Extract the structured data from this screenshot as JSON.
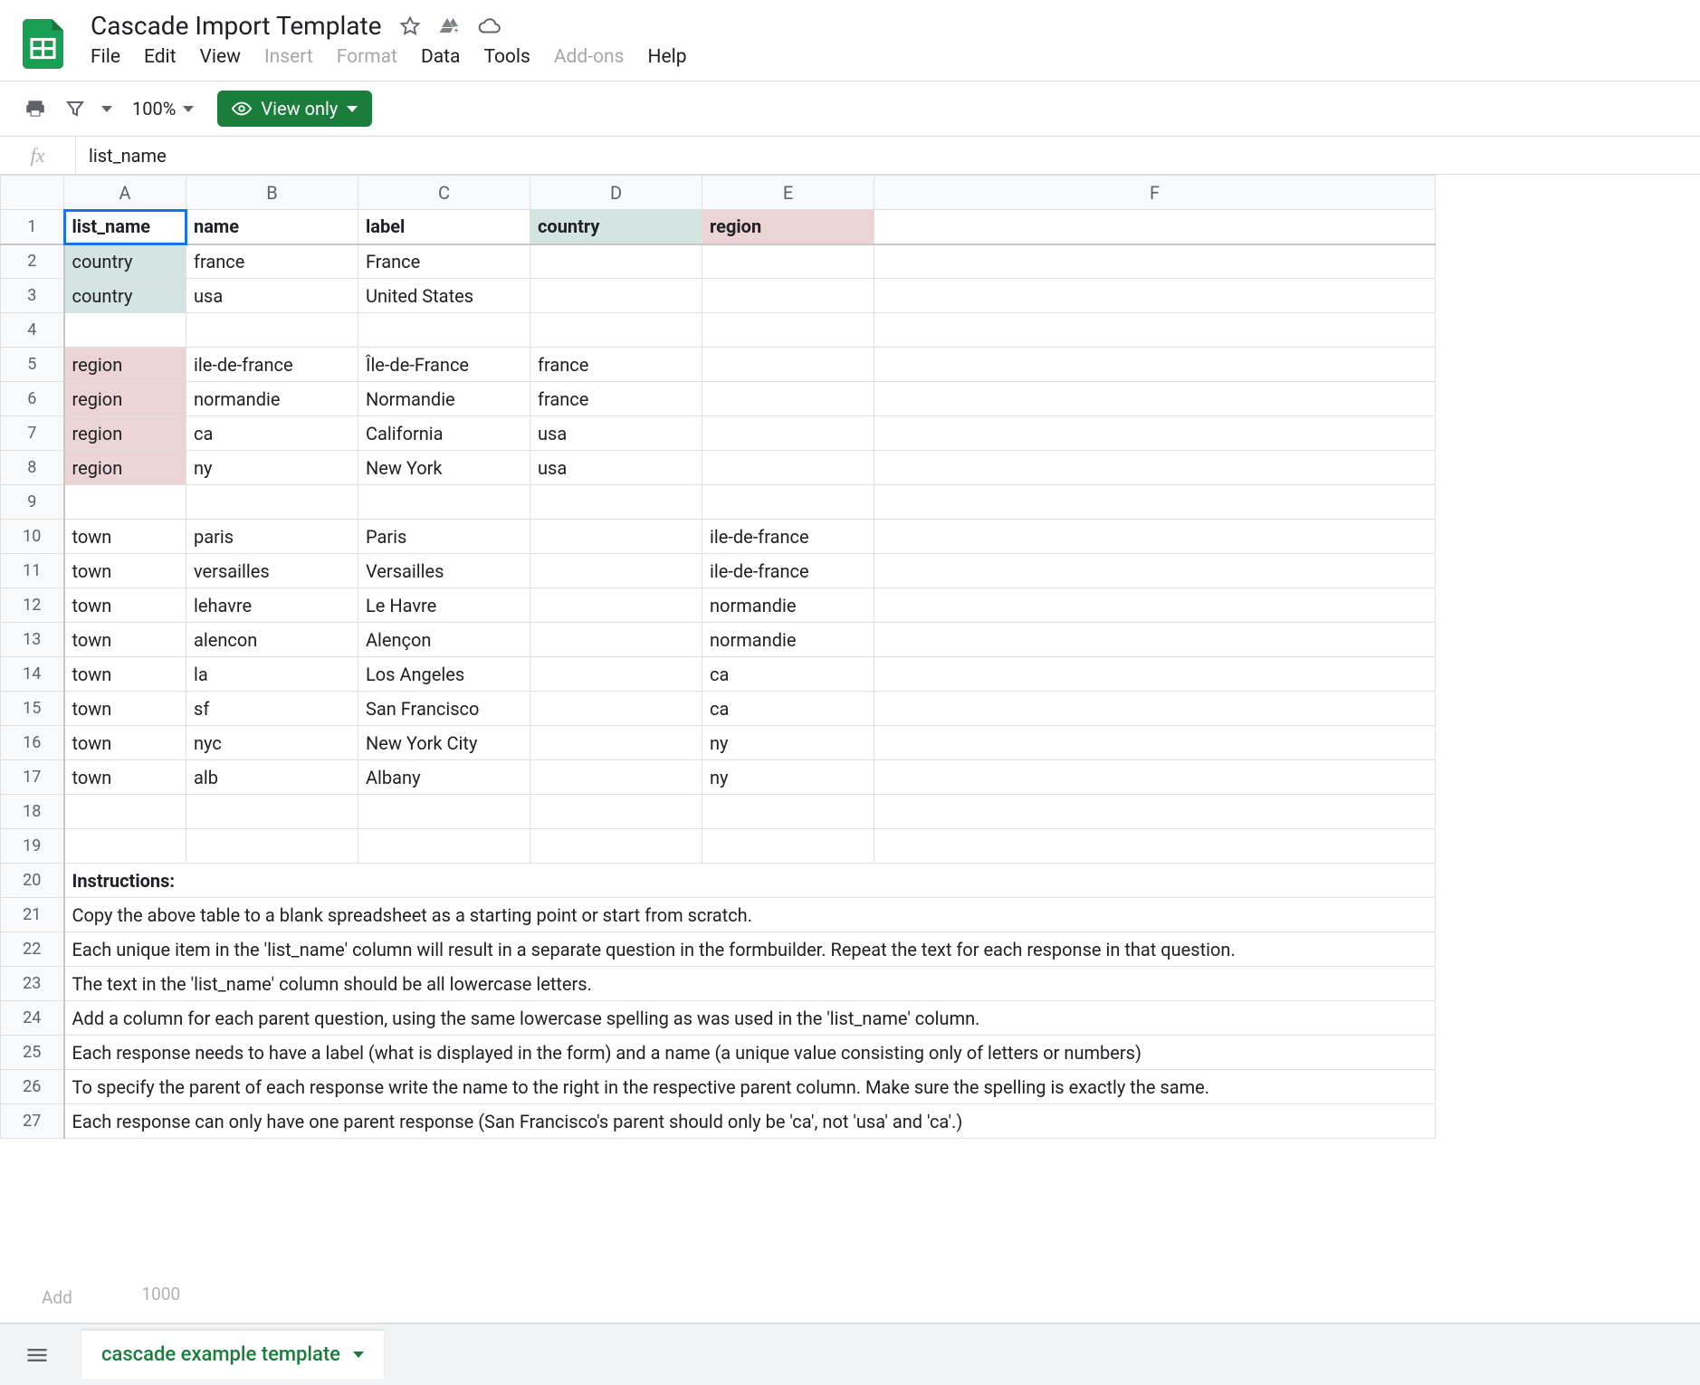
{
  "doc_title": "Cascade Import Template",
  "menus": {
    "file": "File",
    "edit": "Edit",
    "view": "View",
    "insert": "Insert",
    "format": "Format",
    "data": "Data",
    "tools": "Tools",
    "addons": "Add-ons",
    "help": "Help"
  },
  "toolbar": {
    "zoom": "100%",
    "view_only": "View only"
  },
  "formula_bar": {
    "value": "list_name"
  },
  "columns": [
    "A",
    "B",
    "C",
    "D",
    "E",
    "F"
  ],
  "sheet": {
    "header": {
      "A": "list_name",
      "B": "name",
      "C": "label",
      "D": "country",
      "E": "region"
    },
    "rows": [
      {
        "A": "country",
        "B": "france",
        "C": "France",
        "D": "",
        "E": "",
        "a_class": "teal"
      },
      {
        "A": "country",
        "B": "usa",
        "C": "United States",
        "D": "",
        "E": "",
        "a_class": "teal"
      },
      {
        "A": "",
        "B": "",
        "C": "",
        "D": "",
        "E": ""
      },
      {
        "A": "region",
        "B": "ile-de-france",
        "C": "Île-de-France",
        "D": "france",
        "E": "",
        "a_class": "pink"
      },
      {
        "A": "region",
        "B": "normandie",
        "C": "Normandie",
        "D": "france",
        "E": "",
        "a_class": "pink"
      },
      {
        "A": "region",
        "B": "ca",
        "C": "California",
        "D": "usa",
        "E": "",
        "a_class": "pink"
      },
      {
        "A": "region",
        "B": "ny",
        "C": "New York",
        "D": "usa",
        "E": "",
        "a_class": "pink"
      },
      {
        "A": "",
        "B": "",
        "C": "",
        "D": "",
        "E": ""
      },
      {
        "A": "town",
        "B": "paris",
        "C": "Paris",
        "D": "",
        "E": "ile-de-france"
      },
      {
        "A": "town",
        "B": "versailles",
        "C": "Versailles",
        "D": "",
        "E": "ile-de-france"
      },
      {
        "A": "town",
        "B": "lehavre",
        "C": "Le Havre",
        "D": "",
        "E": "normandie"
      },
      {
        "A": "town",
        "B": "alencon",
        "C": "Alençon",
        "D": "",
        "E": "normandie"
      },
      {
        "A": "town",
        "B": "la",
        "C": "Los Angeles",
        "D": "",
        "E": "ca"
      },
      {
        "A": "town",
        "B": "sf",
        "C": "San Francisco",
        "D": "",
        "E": "ca"
      },
      {
        "A": "town",
        "B": "nyc",
        "C": "New York City",
        "D": "",
        "E": "ny"
      },
      {
        "A": "town",
        "B": "alb",
        "C": "Albany",
        "D": "",
        "E": "ny"
      },
      {
        "A": "",
        "B": "",
        "C": "",
        "D": "",
        "E": ""
      },
      {
        "A": "",
        "B": "",
        "C": "",
        "D": "",
        "E": ""
      }
    ],
    "instructions_header": "Instructions:",
    "instructions": [
      "Copy the above table to a blank spreadsheet as a starting point or start from scratch.",
      "Each unique item in the 'list_name' column will result in a separate question in the formbuilder. Repeat the text for each response in that question.",
      "The text in the 'list_name' column should be all lowercase letters.",
      "Add a column for each parent question, using the same lowercase spelling as was used in the 'list_name' column.",
      "Each response needs to have a label (what is displayed in the form) and a name (a unique value consisting only of letters or numbers)",
      "To specify the parent of each response write the name to the right in the respective parent column. Make sure the spelling is exactly the same.",
      "Each response can only have one parent response (San Francisco's parent should only be 'ca', not 'usa' and 'ca'.)"
    ]
  },
  "add_rows": {
    "button": "Add",
    "count": "1000"
  },
  "sheet_tab": "cascade example template"
}
